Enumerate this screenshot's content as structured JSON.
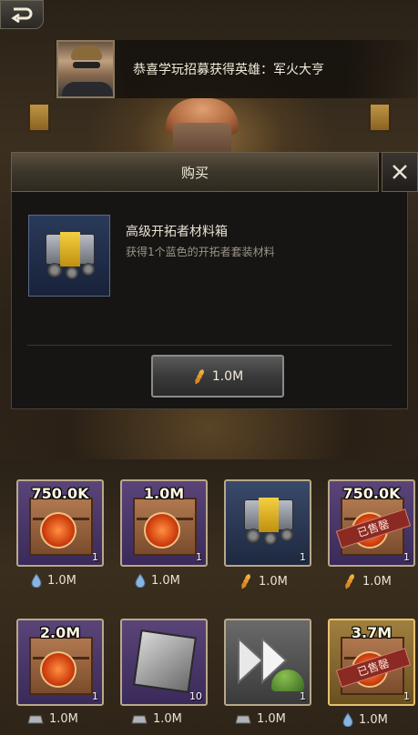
{
  "header": {
    "back_icon": "back-arrow-icon",
    "notice_text": "恭喜学玩招募获得英雄：军火大亨"
  },
  "modal": {
    "title": "购买",
    "close_icon": "close-icon",
    "item_name": "高级开拓者材料箱",
    "item_desc": "获得1个蓝色的开拓者套装材料",
    "buy_price": "1.0M",
    "buy_currency_icon": "wheat-icon"
  },
  "shop": {
    "row1": [
      {
        "amount": "750.0K",
        "qty": "1",
        "price": "1.0M",
        "currency": "water",
        "rarity": "purple",
        "sold": false,
        "sold_label": ""
      },
      {
        "amount": "1.0M",
        "qty": "1",
        "price": "1.0M",
        "currency": "water",
        "rarity": "purple",
        "sold": false,
        "sold_label": ""
      },
      {
        "amount": "",
        "qty": "1",
        "price": "1.0M",
        "currency": "wheat",
        "rarity": "blue",
        "sold": false,
        "sold_label": ""
      },
      {
        "amount": "750.0K",
        "qty": "1",
        "price": "1.0M",
        "currency": "wheat",
        "rarity": "purple",
        "sold": true,
        "sold_label": "已售罄"
      }
    ],
    "row2": [
      {
        "amount": "2.0M",
        "qty": "1",
        "price": "1.0M",
        "currency": "ingot",
        "rarity": "purple",
        "sold": false,
        "sold_label": ""
      },
      {
        "amount": "",
        "qty": "10",
        "price": "1.0M",
        "currency": "ingot",
        "rarity": "purple",
        "sold": false,
        "sold_label": ""
      },
      {
        "amount": "",
        "qty": "1",
        "price": "1.0M",
        "currency": "ingot",
        "rarity": "gray",
        "sold": false,
        "sold_label": ""
      },
      {
        "amount": "3.7M",
        "qty": "1",
        "price": "1.0M",
        "currency": "water",
        "rarity": "gold",
        "sold": true,
        "sold_label": "已售罄"
      }
    ]
  },
  "colors": {
    "gold_accent": "#f4d040",
    "sold_red": "#8a2a22",
    "slot_border": "#b8a88a"
  }
}
